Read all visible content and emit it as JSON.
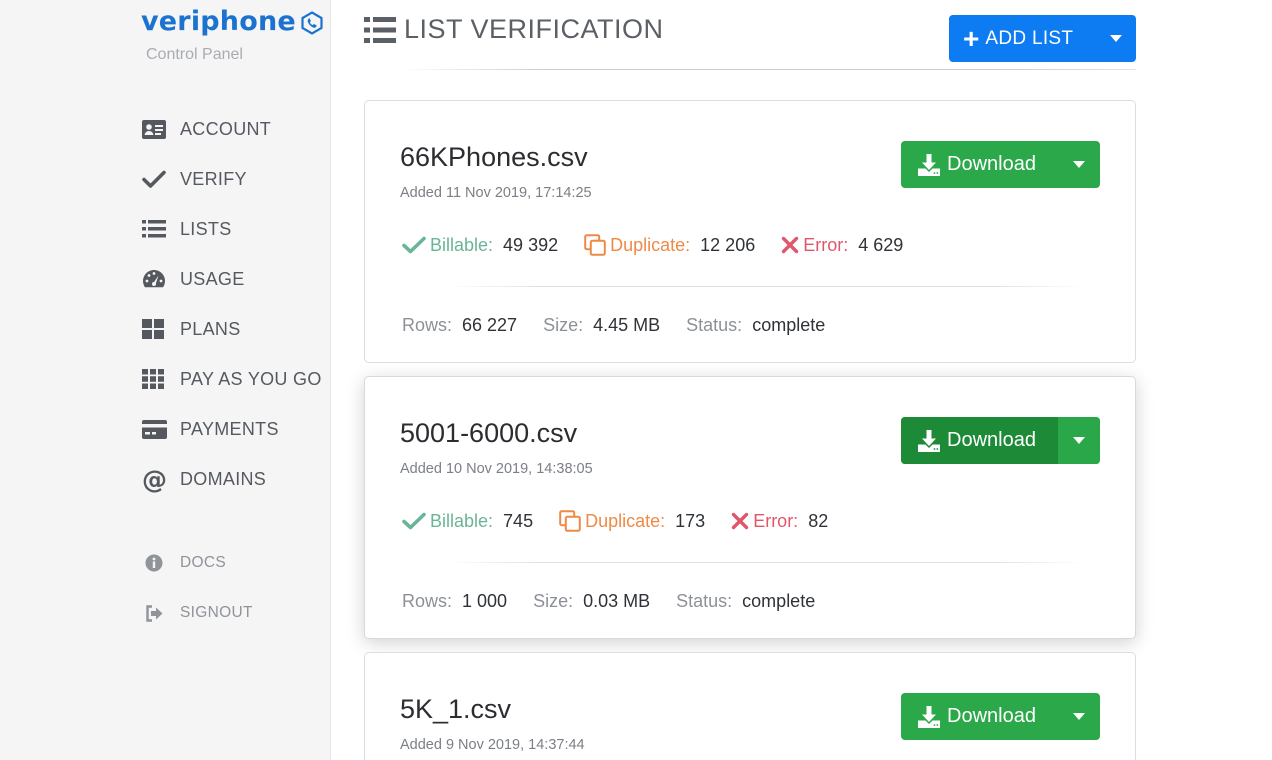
{
  "brand": {
    "name": "veriphone",
    "subtitle": "Control Panel",
    "color": "#1b73cf"
  },
  "sidebar": {
    "items": [
      {
        "label": "ACCOUNT",
        "icon": "id-card-icon"
      },
      {
        "label": "VERIFY",
        "icon": "check-icon"
      },
      {
        "label": "LISTS",
        "icon": "list-icon"
      },
      {
        "label": "USAGE",
        "icon": "gauge-icon"
      },
      {
        "label": "PLANS",
        "icon": "grid-2x2-icon"
      },
      {
        "label": "PAY AS YOU GO",
        "icon": "grid-3x3-icon"
      },
      {
        "label": "PAYMENTS",
        "icon": "credit-card-icon"
      },
      {
        "label": "DOMAINS",
        "icon": "at-icon"
      }
    ],
    "secondary": [
      {
        "label": "DOCS",
        "icon": "info-icon"
      },
      {
        "label": "SIGNOUT",
        "icon": "sign-out-icon"
      }
    ]
  },
  "header": {
    "title": "LIST VERIFICATION",
    "add_button": "ADD LIST"
  },
  "labels": {
    "download": "Download",
    "billable": "Billable:",
    "duplicate": "Duplicate:",
    "error": "Error:",
    "rows": "Rows:",
    "size": "Size:",
    "status": "Status:"
  },
  "colors": {
    "primary": "#0d7bf2",
    "success": "#2ba84a",
    "billable": "#6ab597",
    "duplicate": "#ee8a45",
    "error": "#e0566a"
  },
  "lists": [
    {
      "name": "66KPhones.csv",
      "added": "Added 11 Nov 2019, 17:14:25",
      "billable": "49 392",
      "duplicate": "12 206",
      "error": "4 629",
      "rows": "66 227",
      "size": "4.45 MB",
      "status": "complete"
    },
    {
      "name": "5001-6000.csv",
      "added": "Added 10 Nov 2019, 14:38:05",
      "billable": "745",
      "duplicate": "173",
      "error": "82",
      "rows": "1 000",
      "size": "0.03 MB",
      "status": "complete"
    },
    {
      "name": "5K_1.csv",
      "added": "Added 9 Nov 2019, 14:37:44"
    }
  ]
}
